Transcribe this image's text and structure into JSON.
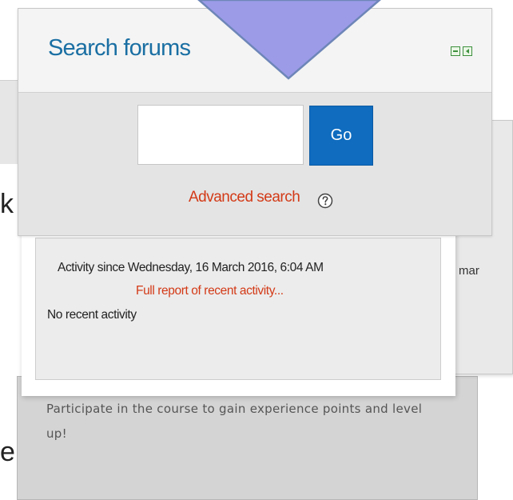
{
  "search_forums": {
    "title": "Search forums",
    "input_value": "",
    "go_label": "Go",
    "advanced_search_label": "Advanced search"
  },
  "recent_activity": {
    "since_text": "Activity since Wednesday, 16 March 2016, 6:04 AM",
    "full_report_label": "Full report of recent activity...",
    "no_activity_text": "No recent activity"
  },
  "level_up": {
    "message": "Participate in the course to gain experience points and level up!"
  },
  "background": {
    "right_card_text": "mar",
    "left_fragment_top": "k",
    "left_fragment_bottom": "e"
  },
  "colors": {
    "title_blue": "#1a6fa3",
    "button_blue": "#0f6cbf",
    "link_red": "#d33a17",
    "arrow_fill": "#9b9be8"
  },
  "icons": {
    "block_controls": [
      "collapse-icon",
      "dock-icon"
    ],
    "help": "help-icon",
    "overlay": "down-arrow-icon"
  }
}
